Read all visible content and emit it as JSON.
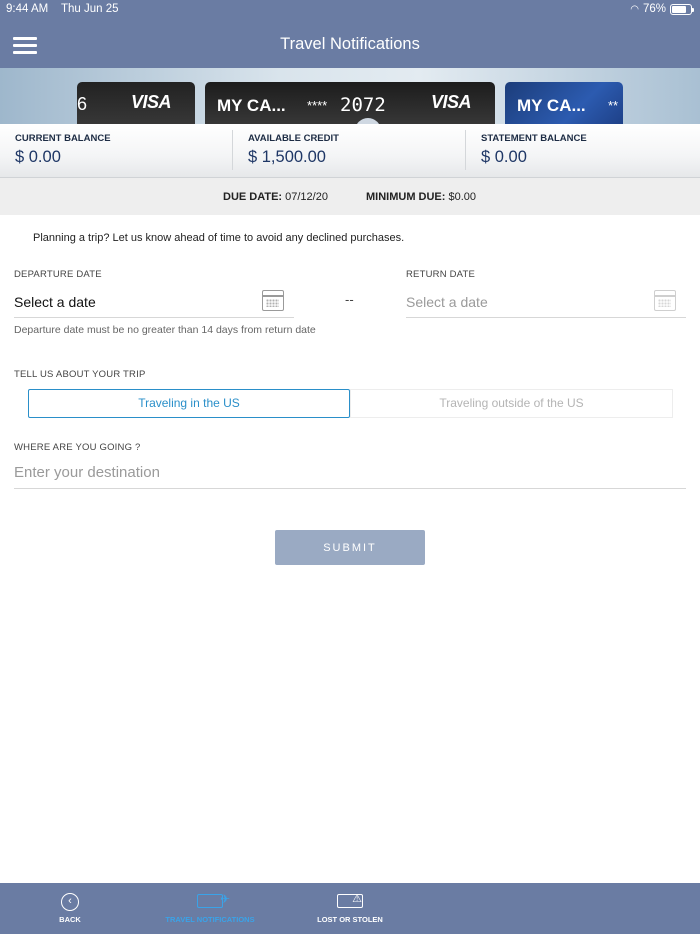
{
  "status_bar": {
    "time": "9:44 AM",
    "date": "Thu Jun 25",
    "battery": "76%",
    "battery_level": 0.76
  },
  "header": {
    "title": "Travel Notifications"
  },
  "cards": {
    "left": {
      "stub": "6",
      "network": "VISA"
    },
    "center": {
      "name": "MY CA...",
      "mask": "****",
      "last4": "2072",
      "network": "VISA"
    },
    "right": {
      "name": "MY CA...",
      "mask": "**"
    }
  },
  "balances": {
    "current": {
      "label": "CURRENT BALANCE",
      "value": "$ 0.00"
    },
    "available": {
      "label": "AVAILABLE CREDIT",
      "value": "$ 1,500.00"
    },
    "statement": {
      "label": "STATEMENT BALANCE",
      "value": "$ 0.00"
    }
  },
  "due": {
    "due_label": "DUE DATE:",
    "due_value": " 07/12/20",
    "min_label": "MINIMUM DUE:",
    "min_value": " $0.00"
  },
  "form": {
    "intro": "Planning a trip? Let us know ahead of time to avoid any declined purchases.",
    "departure_label": "DEPARTURE DATE",
    "departure_value": "Select a date",
    "separator": "--",
    "return_label": "RETURN DATE",
    "return_value": "Select a date",
    "hint": "Departure date must be no greater than 14 days from return date",
    "trip_label": "TELL US ABOUT YOUR TRIP",
    "trip_options": [
      "Traveling in the US",
      "Traveling outside of the US"
    ],
    "trip_selected": "Traveling in the US",
    "destination_label": "WHERE ARE YOU GOING ?",
    "destination_placeholder": "Enter your destination",
    "destination_value": "",
    "submit_label": "SUBMIT"
  },
  "tabbar": {
    "items": [
      {
        "label": "BACK",
        "icon": "back-arrow-icon"
      },
      {
        "label": "TRAVEL NOTIFICATIONS",
        "icon": "travel-card-icon",
        "active": true
      },
      {
        "label": "LOST OR STOLEN",
        "icon": "card-warning-icon"
      }
    ]
  },
  "colors": {
    "header": "#6a7ca3",
    "accent": "#2a8fc9",
    "submit": "#9aaac3",
    "balance_value": "#1f3766"
  }
}
